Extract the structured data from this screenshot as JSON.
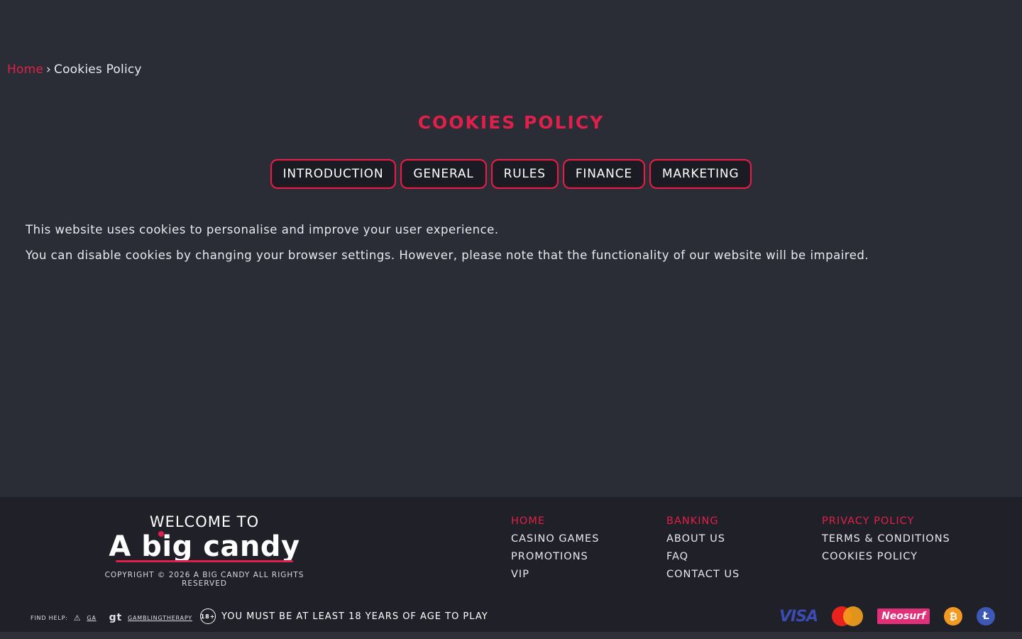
{
  "breadcrumb": {
    "home": "Home",
    "separator": "›",
    "current": "Cookies Policy"
  },
  "page": {
    "title": "COOKIES POLICY"
  },
  "tabs": [
    {
      "label": "INTRODUCTION"
    },
    {
      "label": "GENERAL"
    },
    {
      "label": "RULES"
    },
    {
      "label": "FINANCE"
    },
    {
      "label": "MARKETING"
    }
  ],
  "content": {
    "paragraphs": [
      "This website uses cookies to personalise and improve your user experience.",
      "You can disable cookies by changing your browser settings. However, please note that the functionality of our website will be impaired."
    ]
  },
  "footer": {
    "welcome": "WELCOME TO",
    "logo": "A big candy",
    "copyright": "COPYRIGHT © 2026 A BIG CANDY ALL RIGHTS RESERVED",
    "col1": [
      "HOME",
      "CASINO GAMES",
      "PROMOTIONS",
      "VIP"
    ],
    "col2": [
      "BANKING",
      "ABOUT US",
      "FAQ",
      "CONTACT US"
    ],
    "col3": [
      "PRIVACY POLICY",
      "TERMS & CONDITIONS",
      "COOKIES POLICY"
    ],
    "find_help": "FIND HELP:",
    "ga_label": "GA",
    "gt_label": "gt",
    "gambling_therapy": "GAMBLINGTHERAPY",
    "age_badge": "18+",
    "age_notice": "YOU MUST BE AT LEAST 18 YEARS OF AGE TO PLAY",
    "payments": {
      "visa": "VISA",
      "neosurf": "Neosurf",
      "btc": "₿",
      "ltc": "Ł"
    }
  },
  "colors": {
    "accent": "#e0204a",
    "background": "#2a2d36",
    "footer": "#1f2028"
  }
}
